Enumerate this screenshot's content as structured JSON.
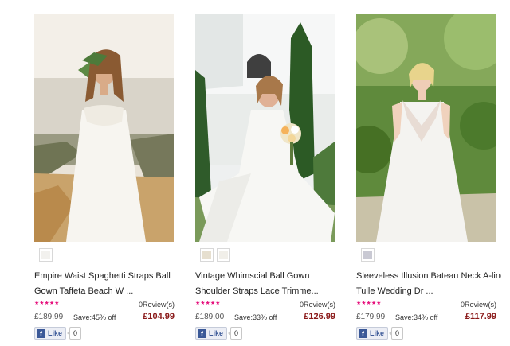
{
  "products": [
    {
      "name_line1": "Empire Waist Spaghetti Straps Ball",
      "name_line2": "Gown Taffeta Beach W ...",
      "stars": "★★★★★",
      "reviews": "0Review(s)",
      "old_price": "£189.99",
      "save": "Save:45% off",
      "price": "£104.99",
      "like_label": "Like",
      "like_count": "0",
      "swatch_color": "#f2f1ee"
    },
    {
      "name_line1": "Vintage Whimscial Ball Gown",
      "name_line2": "Shoulder Straps Lace Trimme...",
      "stars": "★★★★★",
      "reviews": "0Review(s)",
      "old_price": "£189.00",
      "save": "Save:33% off",
      "price": "£126.99",
      "like_label": "Like",
      "like_count": "0",
      "swatch_color": "#e6dfcf"
    },
    {
      "name_line1": "Sleeveless Illusion Bateau Neck A-line",
      "name_line2": "Tulle Wedding Dr ...",
      "stars": "★★★★★",
      "reviews": "0Review(s)",
      "old_price": "£179.99",
      "save": "Save:34% off",
      "price": "£117.99",
      "like_label": "Like",
      "like_count": "0",
      "swatch_color": "#c9c9d3"
    }
  ],
  "colors": {
    "star": "#e6127d",
    "price": "#8b1a1a",
    "facebook": "#3b5998"
  }
}
